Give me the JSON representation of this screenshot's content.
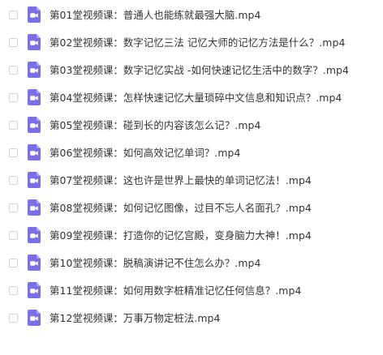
{
  "colors": {
    "icon_fill": "#7b6fe8",
    "text": "#333333",
    "checkbox_border": "#d6d6d6"
  },
  "file_icon": "video-file-icon",
  "files": [
    {
      "name": "第01堂视频课：普通人也能练就最强大脑.mp4"
    },
    {
      "name": "第02堂视频课：数字记忆三法 记忆大师的记忆方法是什么？.mp4"
    },
    {
      "name": "第03堂视频课：数字记忆实战 -如何快速记忆生活中的数字？.mp4"
    },
    {
      "name": "第04堂视频课：怎样快速记忆大量琐碎中文信息和知识点？.mp4"
    },
    {
      "name": "第05堂视频课：碰到长的内容该怎么记？.mp4"
    },
    {
      "name": "第06堂视频课：如何高效记忆单词？.mp4"
    },
    {
      "name": "第07堂视频课：这也许是世界上最快的单词记忆法！.mp4"
    },
    {
      "name": "第08堂视频课：如何记忆图像，过目不忘人名面孔？.mp4"
    },
    {
      "name": "第09堂视频课：打造你的记忆宫殿，变身脑力大神！.mp4"
    },
    {
      "name": "第10堂视频课：脱稿演讲记不住怎么办？.mp4"
    },
    {
      "name": "第11堂视频课：如何用数字桩精准记忆任何信息？.mp4"
    },
    {
      "name": "第12堂视频课：万事万物定桩法.mp4"
    }
  ]
}
